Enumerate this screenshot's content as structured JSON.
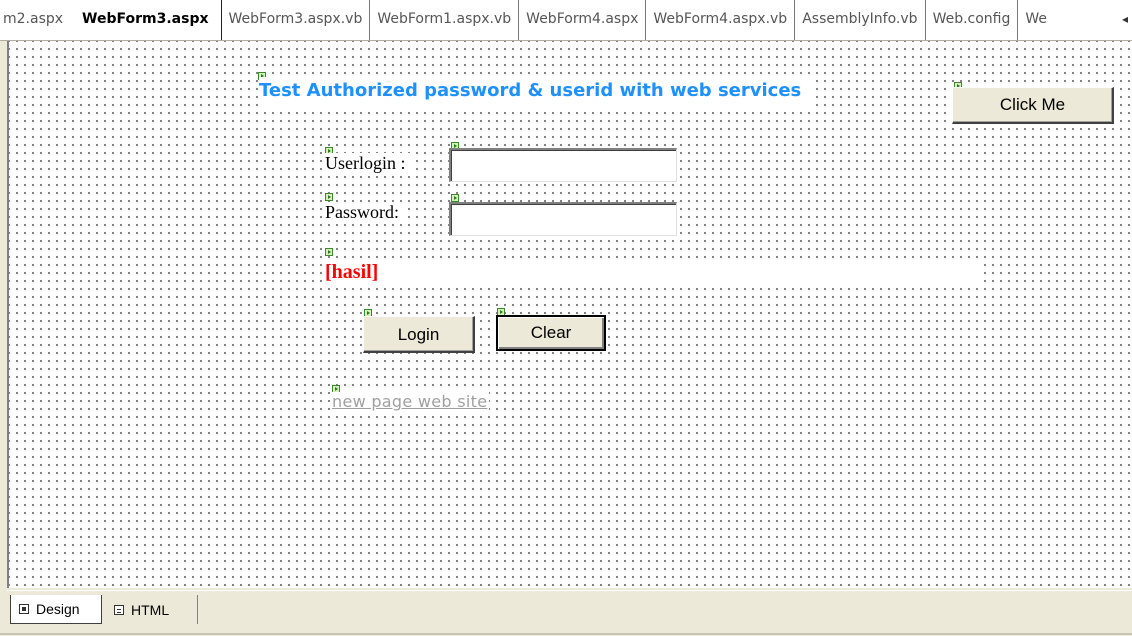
{
  "tabs": [
    {
      "label": "m2.aspx",
      "active": false
    },
    {
      "label": "WebForm3.aspx",
      "active": true
    },
    {
      "label": "WebForm3.aspx.vb",
      "active": false
    },
    {
      "label": "WebForm1.aspx.vb",
      "active": false
    },
    {
      "label": "WebForm4.aspx",
      "active": false
    },
    {
      "label": "WebForm4.aspx.vb",
      "active": false
    },
    {
      "label": "AssemblyInfo.vb",
      "active": false
    },
    {
      "label": "Web.config",
      "active": false
    },
    {
      "label": "We",
      "active": false
    }
  ],
  "form": {
    "title": "Test Authorized password & userid with web services",
    "click_me_label": "Click Me",
    "userlogin_label": "Userlogin :",
    "userlogin_value": "",
    "password_label": "Password:",
    "password_value": "",
    "result_label": "[hasil]",
    "login_label": "Login",
    "clear_label": "Clear",
    "link_text": "new page web site"
  },
  "view_tabs": {
    "design_label": "Design",
    "html_label": "HTML",
    "active": "Design"
  },
  "colors": {
    "title": "#1e90ff",
    "result": "#ff0000",
    "link": "#a0a0a0",
    "chrome": "#ece9d8"
  },
  "icons": {
    "control_glyph": "server-control-icon",
    "tab_scroll": "scroll-right-icon",
    "design_view": "design-view-icon",
    "html_view": "html-view-icon"
  }
}
